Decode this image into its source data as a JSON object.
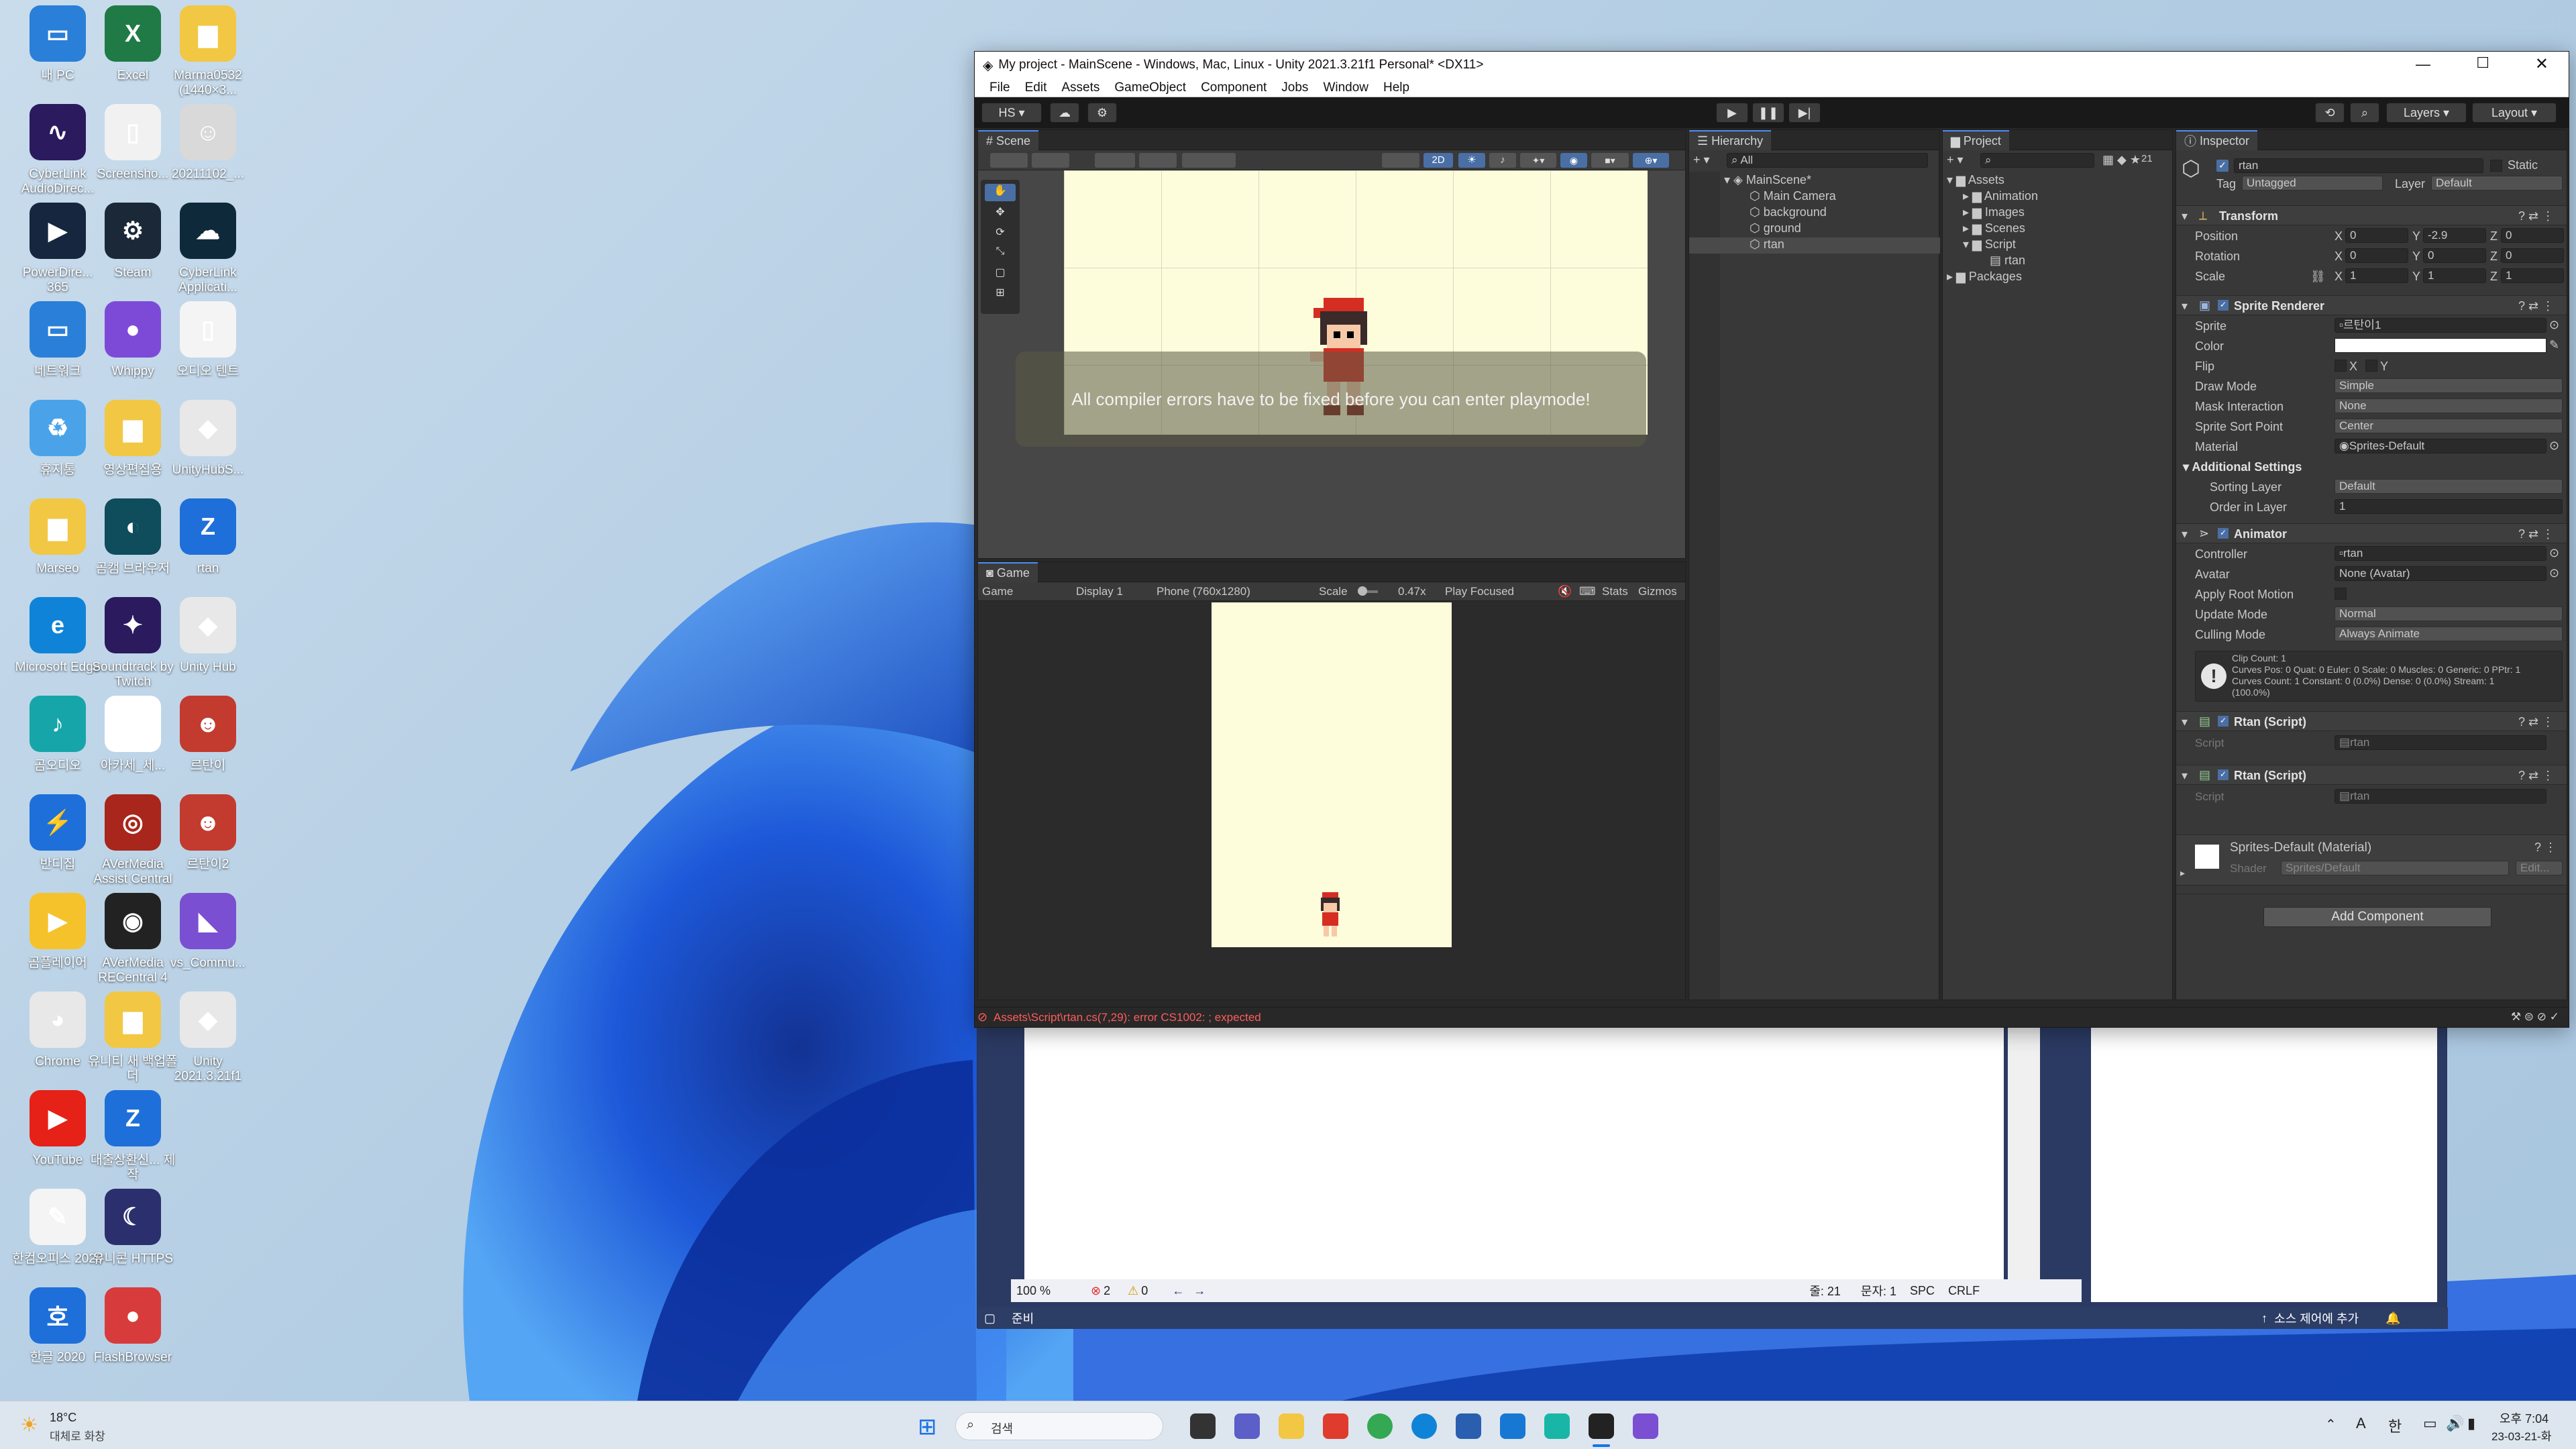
{
  "desktop": {
    "icons": [
      {
        "label": "내 PC",
        "color": "#2a7fd8",
        "glyph": "▭"
      },
      {
        "label": "Excel",
        "color": "#1f7a45",
        "glyph": "X"
      },
      {
        "label": "Marma0532 (1440×3...",
        "color": "#f2c744",
        "glyph": "▆"
      },
      {
        "label": "CyberLink AudioDirec...",
        "color": "#2b1a5e",
        "glyph": "∿"
      },
      {
        "label": "Screensho...",
        "color": "#f1f1f1",
        "glyph": "▯"
      },
      {
        "label": "20211102_...",
        "color": "#d9d9d9",
        "glyph": "☺"
      },
      {
        "label": "PowerDire... 365",
        "color": "#16263e",
        "glyph": "▶"
      },
      {
        "label": "Steam",
        "color": "#1b2838",
        "glyph": "⚙"
      },
      {
        "label": "CyberLink Applicati...",
        "color": "#0e2a3a",
        "glyph": "☁"
      },
      {
        "label": "네트워크",
        "color": "#2a7fd8",
        "glyph": "▭"
      },
      {
        "label": "Whippy",
        "color": "#7d4ad8",
        "glyph": "●"
      },
      {
        "label": "오디오 텐트",
        "color": "#f4f4f4",
        "glyph": "▯"
      },
      {
        "label": "휴지통",
        "color": "#4aa3e8",
        "glyph": "♻"
      },
      {
        "label": "영상편집용",
        "color": "#f2c744",
        "glyph": "▆"
      },
      {
        "label": "UnityHubS...",
        "color": "#e8e8e8",
        "glyph": "◆"
      },
      {
        "label": "Marseo",
        "color": "#f2c744",
        "glyph": "▆"
      },
      {
        "label": "곰캠 브라우저",
        "color": "#0f4c5c",
        "glyph": "◐"
      },
      {
        "label": "rtan",
        "color": "#1e6fd9",
        "glyph": "Z"
      },
      {
        "label": "Microsoft Edge",
        "color": "#0f83d8",
        "glyph": "e"
      },
      {
        "label": "Soundtrack by Twitch",
        "color": "#2b1a5e",
        "glyph": "✦"
      },
      {
        "label": "Unity Hub",
        "color": "#e8e8e8",
        "glyph": "◆"
      },
      {
        "label": "곰오디오",
        "color": "#16a5a8",
        "glyph": "♪"
      },
      {
        "label": "아카세_세...",
        "color": "#ffffff",
        "glyph": "호"
      },
      {
        "label": "르탄이",
        "color": "#c23b2e",
        "glyph": "☻"
      },
      {
        "label": "반디집",
        "color": "#1e6fd9",
        "glyph": "⚡"
      },
      {
        "label": "AVerMedia Assist Central",
        "color": "#a8261b",
        "glyph": "◎"
      },
      {
        "label": "르탄이2",
        "color": "#c23b2e",
        "glyph": "☻"
      },
      {
        "label": "곰플레이어",
        "color": "#f5c22b",
        "glyph": "▶"
      },
      {
        "label": "AVerMedia RECentral 4",
        "color": "#222222",
        "glyph": "◉"
      },
      {
        "label": "vs_Commu...",
        "color": "#7a4fd1",
        "glyph": "◣"
      },
      {
        "label": "Chrome",
        "color": "#e8e8e8",
        "glyph": "◕"
      },
      {
        "label": "유니티 새 백업폴더",
        "color": "#f2c744",
        "glyph": "▆"
      },
      {
        "label": "Unity 2021.3.21f1",
        "color": "#e8e8e8",
        "glyph": "◆"
      },
      {
        "label": "YouTube",
        "color": "#e62117",
        "glyph": "▶"
      },
      {
        "label": "대출상환신... 제작",
        "color": "#1e6fd9",
        "glyph": "Z"
      },
      {
        "label": "",
        "color": "transparent",
        "glyph": ""
      },
      {
        "label": "한컴오피스 2020",
        "color": "#f4f4f4",
        "glyph": "✎"
      },
      {
        "label": "유니콘 HTTPS",
        "color": "#2b2f6e",
        "glyph": "☾"
      },
      {
        "label": "",
        "color": "transparent",
        "glyph": ""
      },
      {
        "label": "한글 2020",
        "color": "#1e6fd9",
        "glyph": "호"
      },
      {
        "label": "FlashBrowser",
        "color": "#d83b3b",
        "glyph": "●"
      }
    ]
  },
  "unity": {
    "title": "My project - MainScene - Windows, Mac, Linux - Unity 2021.3.21f1 Personal* <DX11>",
    "menu": [
      "File",
      "Edit",
      "Assets",
      "GameObject",
      "Component",
      "Jobs",
      "Window",
      "Help"
    ],
    "toolbar": {
      "account": "HS ▾",
      "layers": "Layers",
      "layout": "Layout"
    },
    "scene": {
      "tab": "Scene",
      "mode2d": "2D",
      "message": "All compiler errors have to be fixed before you can enter playmode!"
    },
    "game": {
      "tab": "Game",
      "view_mode": "Game",
      "display": "Display 1",
      "resolution": "Phone (760x1280)",
      "scale_label": "Scale",
      "scale_value": "0.47x",
      "play_mode": "Play Focused",
      "stats": "Stats",
      "gizmos": "Gizmos"
    },
    "hierarchy": {
      "tab": "Hierarchy",
      "search": "All",
      "scene_name": "MainScene*",
      "items": [
        "Main Camera",
        "background",
        "ground",
        "rtan"
      ]
    },
    "project": {
      "tab": "Project",
      "count": "21",
      "root": "Assets",
      "folders": [
        "Animation",
        "Images",
        "Scenes",
        "Script"
      ],
      "script_child": "rtan",
      "packages": "Packages"
    },
    "inspector": {
      "tab": "Inspector",
      "object_name": "rtan",
      "static_label": "Static",
      "tag_label": "Tag",
      "tag_value": "Untagged",
      "layer_label": "Layer",
      "layer_value": "Default",
      "transform": {
        "title": "Transform",
        "rows": [
          {
            "label": "Position",
            "x": "0",
            "y": "-2.9",
            "z": "0"
          },
          {
            "label": "Rotation",
            "x": "0",
            "y": "0",
            "z": "0"
          },
          {
            "label": "Scale",
            "x": "1",
            "y": "1",
            "z": "1"
          }
        ]
      },
      "sprite_renderer": {
        "title": "Sprite Renderer",
        "sprite_label": "Sprite",
        "sprite_value": "르탄이1",
        "color_label": "Color",
        "flip_label": "Flip",
        "flip_x": "X",
        "flip_y": "Y",
        "draw_mode_label": "Draw Mode",
        "draw_mode_value": "Simple",
        "mask_label": "Mask Interaction",
        "mask_value": "None",
        "sort_point_label": "Sprite Sort Point",
        "sort_point_value": "Center",
        "material_label": "Material",
        "material_value": "Sprites-Default",
        "additional_label": "Additional Settings",
        "sorting_layer_label": "Sorting Layer",
        "sorting_layer_value": "Default",
        "order_label": "Order in Layer",
        "order_value": "1"
      },
      "animator": {
        "title": "Animator",
        "controller_label": "Controller",
        "controller_value": "rtan",
        "avatar_label": "Avatar",
        "avatar_value": "None (Avatar)",
        "root_motion_label": "Apply Root Motion",
        "update_label": "Update Mode",
        "update_value": "Normal",
        "culling_label": "Culling Mode",
        "culling_value": "Always Animate",
        "info_line1": "Clip Count: 1",
        "info_line2": "Curves Pos: 0 Quat: 0 Euler: 0 Scale: 0 Muscles: 0 Generic: 0 PPtr: 1",
        "info_line3": "Curves Count: 1 Constant: 0 (0.0%) Dense: 0 (0.0%) Stream: 1",
        "info_line4": "(100.0%)"
      },
      "scripts": [
        {
          "title": "Rtan (Script)",
          "script_label": "Script",
          "script_value": "rtan"
        },
        {
          "title": "Rtan (Script)",
          "script_label": "Script",
          "script_value": "rtan"
        }
      ],
      "material": {
        "title": "Sprites-Default (Material)",
        "shader_label": "Shader",
        "shader_value": "Sprites/Default",
        "edit": "Edit..."
      },
      "add_component": "Add Component"
    },
    "console_error": "Assets\\Script\\rtan.cs(7,29): error CS1002: ; expected"
  },
  "vs": {
    "zoom": "100 %",
    "errors": "2",
    "warnings": "0",
    "line": "줄: 21",
    "char": "문자: 1",
    "spc": "SPC",
    "crlf": "CRLF",
    "status": "준비",
    "source_control": "소스 제어에 추가"
  },
  "taskbar": {
    "weather_temp": "18°C",
    "weather_desc": "대체로 화창",
    "search": "검색",
    "ime1": "A",
    "ime2": "한",
    "time": "오후 7:04",
    "date": "23-03-21-화"
  }
}
